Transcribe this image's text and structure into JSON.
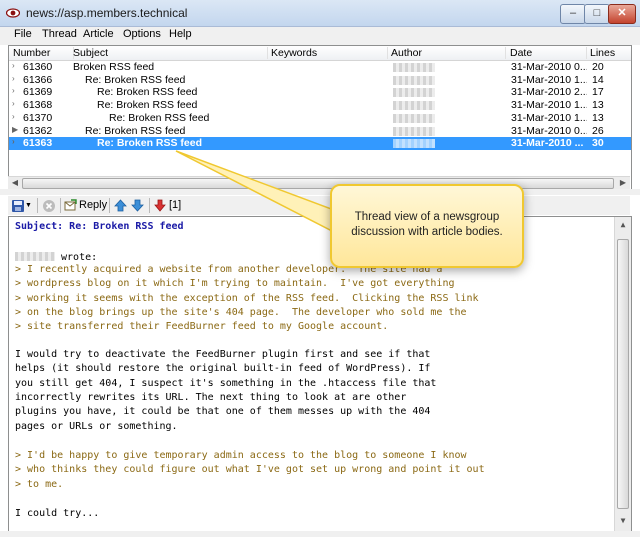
{
  "window": {
    "title": "news://asp.members.technical",
    "min": "–",
    "max": "□",
    "close": "✕"
  },
  "menu": [
    "File",
    "Thread",
    "Article",
    "Options",
    "Help"
  ],
  "columns": [
    "Number",
    "Subject",
    "Keywords",
    "Author",
    "Date",
    "Lines"
  ],
  "rows": [
    {
      "number": "61360",
      "subject": "Broken RSS feed",
      "indent": 0,
      "date": "31-Mar-2010 0...",
      "lines": "20",
      "marker": "›",
      "selected": false
    },
    {
      "number": "61366",
      "subject": "Re: Broken RSS feed",
      "indent": 1,
      "date": "31-Mar-2010 1...",
      "lines": "14",
      "marker": "›",
      "selected": false
    },
    {
      "number": "61369",
      "subject": "Re: Broken RSS feed",
      "indent": 2,
      "date": "31-Mar-2010 2...",
      "lines": "17",
      "marker": "›",
      "selected": false
    },
    {
      "number": "61368",
      "subject": "Re: Broken RSS feed",
      "indent": 2,
      "date": "31-Mar-2010 1...",
      "lines": "13",
      "marker": "›",
      "selected": false
    },
    {
      "number": "61370",
      "subject": "Re: Broken RSS feed",
      "indent": 3,
      "date": "31-Mar-2010 1...",
      "lines": "13",
      "marker": "›",
      "selected": false
    },
    {
      "number": "61362",
      "subject": "Re: Broken RSS feed",
      "indent": 1,
      "date": "31-Mar-2010 0...",
      "lines": "26",
      "marker": "▶",
      "selected": false
    },
    {
      "number": "61363",
      "subject": "Re: Broken RSS feed",
      "indent": 2,
      "date": "31-Mar-2010 ...",
      "lines": "30",
      "marker": "›",
      "selected": true
    }
  ],
  "toolbar": {
    "reply": "Reply",
    "count": "[1]"
  },
  "article": {
    "subject": "Subject: Re: Broken RSS feed",
    "wrote": " wrote:",
    "quote1": [
      "> I recently acquired a website from another developer.  The site had a",
      "> wordpress blog on it which I'm trying to maintain.  I've got everything",
      "> working it seems with the exception of the RSS feed.  Clicking the RSS link",
      "> on the blog brings up the site's 404 page.  The developer who sold me the",
      "> site transferred their FeedBurner feed to my Google account."
    ],
    "body": [
      "I would try to deactivate the FeedBurner plugin first and see if that",
      "helps (it should restore the original built-in feed of WordPress). If",
      "you still get 404, I suspect it's something in the .htaccess file that",
      "incorrectly rewrites its URL. The next thing to look at are other",
      "plugins you have, it could be that one of them messes up with the 404",
      "pages or URLs or something."
    ],
    "quote2": [
      "> I'd be happy to give temporary admin access to the blog to someone I know",
      "> who thinks they could figure out what I've got set up wrong and point it out",
      "> to me."
    ],
    "closing": "I could try..."
  },
  "callout": {
    "line1": "Thread view of a newsgroup",
    "line2": "discussion with article bodies."
  }
}
